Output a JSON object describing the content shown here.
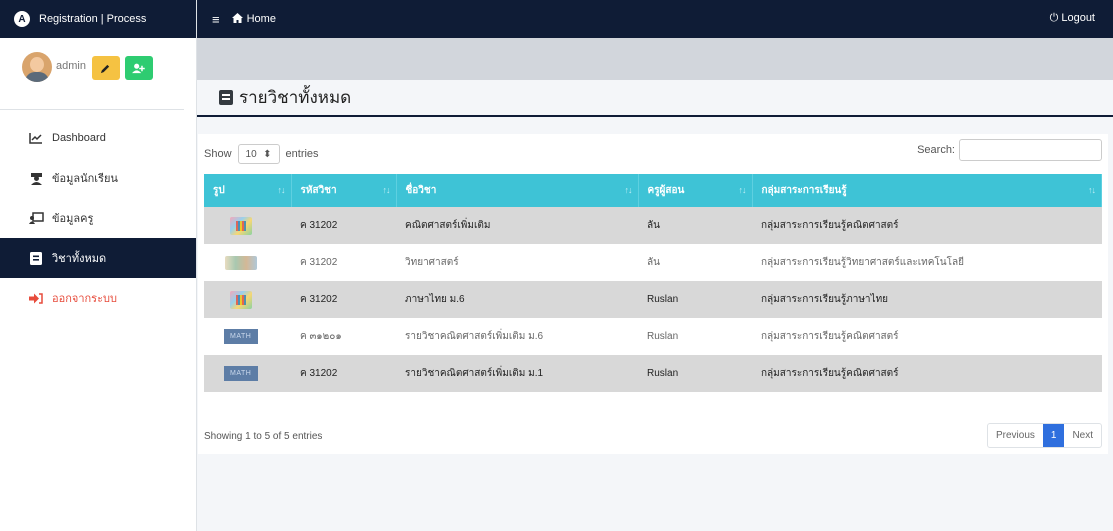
{
  "app": {
    "brand": "Registration | Process",
    "brand_logo": "A"
  },
  "user": {
    "name": "admin"
  },
  "sidebar": {
    "items": [
      {
        "label": "Dashboard",
        "icon": "chart-line-icon"
      },
      {
        "label": "ข้อมูลนักเรียน",
        "icon": "student-icon"
      },
      {
        "label": "ข้อมูลครู",
        "icon": "teacher-board-icon"
      },
      {
        "label": "วิชาทั้งหมด",
        "icon": "book-icon"
      },
      {
        "label": "ออกจากระบบ",
        "icon": "sign-out-icon"
      }
    ]
  },
  "topbar": {
    "home": "Home",
    "logout": "Logout"
  },
  "page": {
    "title": "รายวิชาทั้งหมด"
  },
  "table_tools": {
    "show": "Show",
    "entries_value": "10",
    "entries": "entries",
    "search": "Search:"
  },
  "table": {
    "headers": [
      "รูป",
      "รหัสวิชา",
      "ชื่อวิชา",
      "ครูผู้สอน",
      "กลุ่มสาระการเรียนรู้"
    ],
    "rows": [
      {
        "thumb": "colorful-books",
        "code": "ค 31202",
        "name": "คณิตศาสตร์เพิ่มเติม",
        "teacher": "ลัน",
        "group": "กลุ่มสาระการเรียนรู้คณิตศาสตร์"
      },
      {
        "thumb": "science-banner",
        "code": "ค 31202",
        "name": "วิทยาศาสตร์",
        "teacher": "ลัน",
        "group": "กลุ่มสาระการเรียนรู้วิทยาศาสตร์และเทคโนโลยี"
      },
      {
        "thumb": "colorful-books",
        "code": "ค 31202",
        "name": "ภาษาไทย ม.6",
        "teacher": "Ruslan",
        "group": "กลุ่มสาระการเรียนรู้ภาษาไทย"
      },
      {
        "thumb": "math-banner",
        "thumb_text": "MATH",
        "code": "ค ๓๑๒๐๑",
        "name": "รายวิชาคณิตศาสตร์เพิ่มเติม ม.6",
        "teacher": "Ruslan",
        "group": "กลุ่มสาระการเรียนรู้คณิตศาสตร์"
      },
      {
        "thumb": "math-banner",
        "thumb_text": "MATH",
        "code": "ค 31202",
        "name": "รายวิชาคณิตศาสตร์เพิ่มเติม ม.1",
        "teacher": "Ruslan",
        "group": "กลุ่มสาระการเรียนรู้คณิตศาสตร์"
      }
    ]
  },
  "footer": {
    "info": "Showing 1 to 5 of 5 entries",
    "previous": "Previous",
    "page": "1",
    "next": "Next"
  },
  "colors": {
    "navy": "#0f1c36",
    "table_header": "#3ec3d6",
    "edit_button": "#f5c242",
    "add_button": "#2ecc71",
    "logout_text": "#e74c3c",
    "page_active": "#2f6fde"
  }
}
